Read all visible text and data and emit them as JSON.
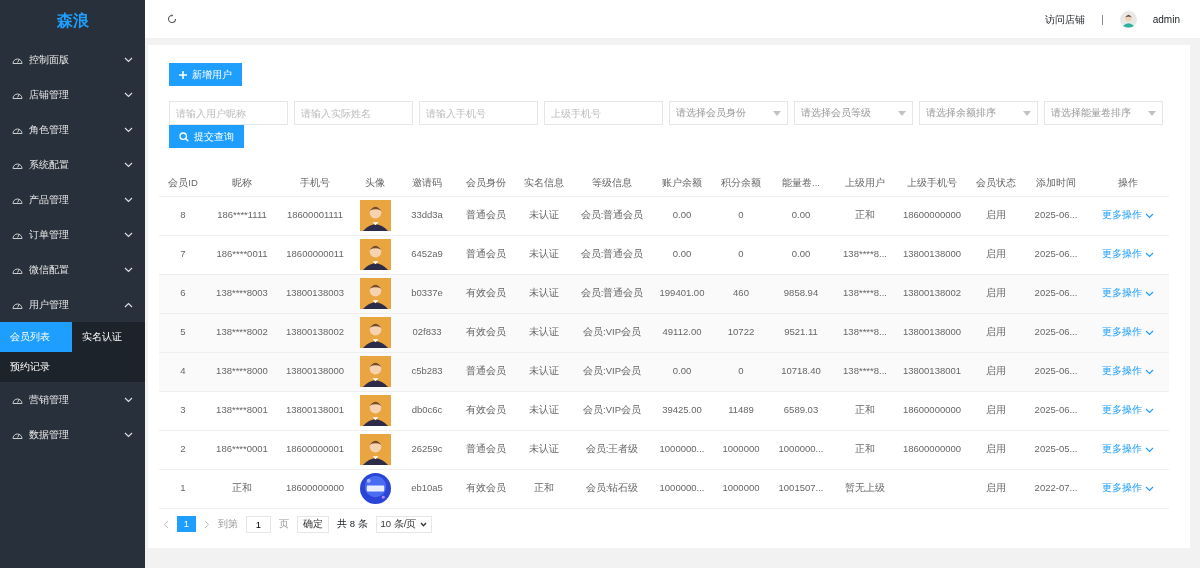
{
  "sidebar": {
    "logo": "森浪",
    "items": [
      {
        "label": "控制面版",
        "expanded": false
      },
      {
        "label": "店铺管理",
        "expanded": false
      },
      {
        "label": "角色管理",
        "expanded": false
      },
      {
        "label": "系统配置",
        "expanded": false
      },
      {
        "label": "产品管理",
        "expanded": false
      },
      {
        "label": "订单管理",
        "expanded": false
      },
      {
        "label": "微信配置",
        "expanded": false
      },
      {
        "label": "用户管理",
        "expanded": true,
        "children": [
          {
            "label": "会员列表",
            "selected": true
          },
          {
            "label": "实名认证",
            "selected": false
          },
          {
            "label": "预约记录",
            "selected": false
          }
        ]
      },
      {
        "label": "营销管理",
        "expanded": false
      },
      {
        "label": "数据管理",
        "expanded": false
      }
    ]
  },
  "header": {
    "link": "访问店铺",
    "separator": "|",
    "user": "admin"
  },
  "toolbar": {
    "add_button": "新增用户",
    "search_button": "提交查询"
  },
  "filters": [
    {
      "kind": "input",
      "placeholder": "请输入用户昵称"
    },
    {
      "kind": "input",
      "placeholder": "请输入实际姓名"
    },
    {
      "kind": "input",
      "placeholder": "请输入手机号"
    },
    {
      "kind": "input",
      "placeholder": "上级手机号"
    },
    {
      "kind": "select",
      "placeholder": "请选择会员身份"
    },
    {
      "kind": "select",
      "placeholder": "请选择会员等级"
    },
    {
      "kind": "select",
      "placeholder": "请选择余额排序"
    },
    {
      "kind": "select",
      "placeholder": "请选择能量卷排序"
    }
  ],
  "table": {
    "columns": [
      "会员ID",
      "昵称",
      "手机号",
      "头像",
      "邀请码",
      "会员身份",
      "实名信息",
      "等级信息",
      "账户余额",
      "积分余额",
      "能量卷...",
      "上级用户",
      "上级手机号",
      "会员状态",
      "添加时间",
      "操作"
    ],
    "rows": [
      {
        "cells": [
          "8",
          "186****1111",
          "18600001111",
          {
            "kind": "picture"
          },
          "33dd3a",
          "普通会员",
          "未认证",
          "会员:普通会员",
          "0.00",
          "0",
          "0.00",
          "正和",
          "18600000000",
          "启用",
          "2025-06..."
        ],
        "action": "更多操作"
      },
      {
        "cells": [
          "7",
          "186****0011",
          "18600000011",
          {
            "kind": "picture"
          },
          "6452a9",
          "普通会员",
          "未认证",
          "会员:普通会员",
          "0.00",
          "0",
          "0.00",
          "138****8...",
          "13800138000",
          "启用",
          "2025-06..."
        ],
        "action": "更多操作"
      },
      {
        "cells": [
          "6",
          "138****8003",
          "13800138003",
          {
            "kind": "picture"
          },
          "b0337e",
          "有效会员",
          "未认证",
          "会员:普通会员",
          "199401.00",
          "460",
          "9858.94",
          "138****8...",
          "13800138002",
          "启用",
          "2025-06..."
        ],
        "action": "更多操作"
      },
      {
        "cells": [
          "5",
          "138****8002",
          "13800138002",
          {
            "kind": "picture"
          },
          "02f833",
          "有效会员",
          "未认证",
          "会员:VIP会员",
          "49112.00",
          "10722",
          "9521.11",
          "138****8...",
          "13800138000",
          "启用",
          "2025-06..."
        ],
        "action": "更多操作"
      },
      {
        "cells": [
          "4",
          "138****8000",
          "13800138000",
          {
            "kind": "picture"
          },
          "c5b283",
          "普通会员",
          "未认证",
          "会员:VIP会员",
          "0.00",
          "0",
          "10718.40",
          "138****8...",
          "13800138001",
          "启用",
          "2025-06..."
        ],
        "action": "更多操作"
      },
      {
        "cells": [
          "3",
          "138****8001",
          "13800138001",
          {
            "kind": "picture"
          },
          "db0c6c",
          "有效会员",
          "未认证",
          "会员:VIP会员",
          "39425.00",
          "11489",
          "6589.03",
          "正和",
          "18600000000",
          "启用",
          "2025-06..."
        ],
        "action": "更多操作"
      },
      {
        "cells": [
          "2",
          "186****0001",
          "18600000001",
          {
            "kind": "picture"
          },
          "26259c",
          "普通会员",
          "未认证",
          "会员:王者级",
          "1000000...",
          "1000000",
          "1000000...",
          "正和",
          "18600000000",
          "启用",
          "2025-05..."
        ],
        "action": "更多操作"
      },
      {
        "cells": [
          "1",
          "正和",
          "18600000000",
          {
            "kind": "picture"
          },
          "eb10a5",
          "有效会员",
          "正和",
          "会员:钻石级",
          "1000000...",
          "1000000",
          "1001507...",
          "暂无上级",
          "",
          "启用",
          "2022-07..."
        ],
        "action": "更多操作"
      }
    ]
  },
  "pagination": {
    "pages": [
      {
        "label": "1",
        "selected": true
      }
    ],
    "goto_label": "到第",
    "goto_value": "1",
    "page_unit": "页",
    "confirm": "确定",
    "total": "共 8 条",
    "page_size": "10 条/页"
  }
}
